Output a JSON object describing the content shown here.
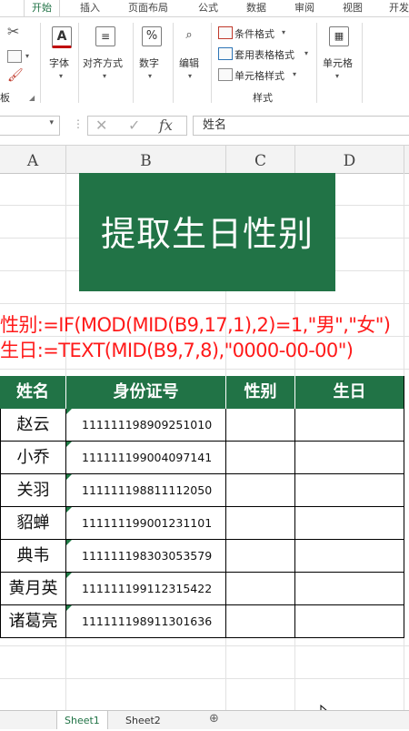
{
  "ribbon": {
    "tabs": [
      "开始",
      "插入",
      "页面布局",
      "公式",
      "数据",
      "审阅",
      "视图",
      "开发"
    ],
    "groups": {
      "font": "字体",
      "alignment": "对齐方式",
      "number": "数字",
      "editing": "编辑",
      "conditional_format": "条件格式",
      "table_format": "套用表格格式",
      "cell_style": "单元格样式",
      "styles_group": "样式",
      "cells": "单元格",
      "clipboard_fragment": "板"
    }
  },
  "formula_bar": {
    "fx_label": "fx",
    "content": "姓名"
  },
  "columns": [
    "A",
    "B",
    "C",
    "D"
  ],
  "sheet": {
    "title": "提取生日性别",
    "formula_gender": "性别:=IF(MOD(MID(B9,17,1),2)=1,\"男\",\"女\")",
    "formula_birthday": "生日:=TEXT(MID(B9,7,8),\"0000-00-00\")"
  },
  "table": {
    "headers": [
      "姓名",
      "身份证号",
      "性别",
      "生日"
    ],
    "rows": [
      {
        "name": "赵云",
        "id": "111111198909251010"
      },
      {
        "name": "小乔",
        "id": "111111199004097141"
      },
      {
        "name": "关羽",
        "id": "111111198811112050"
      },
      {
        "name": "貂蝉",
        "id": "111111199001231101"
      },
      {
        "name": "典韦",
        "id": "111111198303053579"
      },
      {
        "name": "黄月英",
        "id": "111111199112315422"
      },
      {
        "name": "诸葛亮",
        "id": "111111198911301636"
      }
    ]
  },
  "sheet_tabs": [
    "Sheet1",
    "Sheet2"
  ],
  "colors": {
    "accent_green": "#217346",
    "formula_red": "#ff1a1a"
  }
}
